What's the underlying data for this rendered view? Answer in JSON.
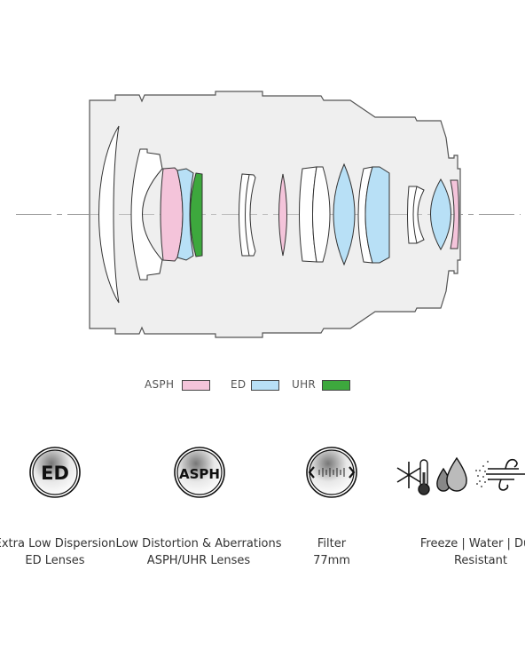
{
  "legend": [
    {
      "label": "ASPH",
      "color": "#f4c4da"
    },
    {
      "label": "ED",
      "color": "#b8e0f6"
    },
    {
      "label": "UHR",
      "color": "#3da83d"
    }
  ],
  "colors": {
    "housing": "#efefef",
    "outline": "#555555",
    "plain_element": "#ffffff"
  },
  "features": [
    {
      "icon": "ed-badge-icon",
      "badge": "ED",
      "line1": "Extra Low Dispersion",
      "line2": "ED Lenses"
    },
    {
      "icon": "asph-badge-icon",
      "badge": "ASPH",
      "line1": "Low Distortion & Aberrations",
      "line2": "ASPH/UHR Lenses"
    },
    {
      "icon": "filter-thread-icon",
      "badge": "",
      "line1": "Filter",
      "line2": "77mm"
    },
    {
      "icon": "freeze-water-dust-icon",
      "badge": "",
      "line1": "Freeze | Water | Dust",
      "line2": "Resistant"
    }
  ]
}
